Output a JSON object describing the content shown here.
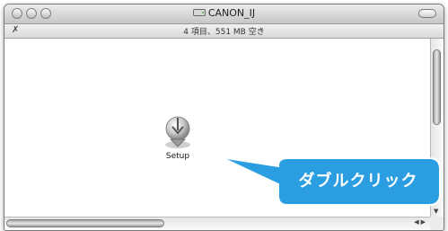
{
  "window": {
    "title": "CANON_IJ",
    "status": "4 項目、551 MB 空き"
  },
  "icons": {
    "disk": "disk-icon",
    "lock": "lock-icon"
  },
  "files": [
    {
      "label": "Setup",
      "icon": "setup-installer-icon"
    }
  ],
  "callout": {
    "text": "ダブルクリック",
    "color": "#2a9ee0"
  }
}
